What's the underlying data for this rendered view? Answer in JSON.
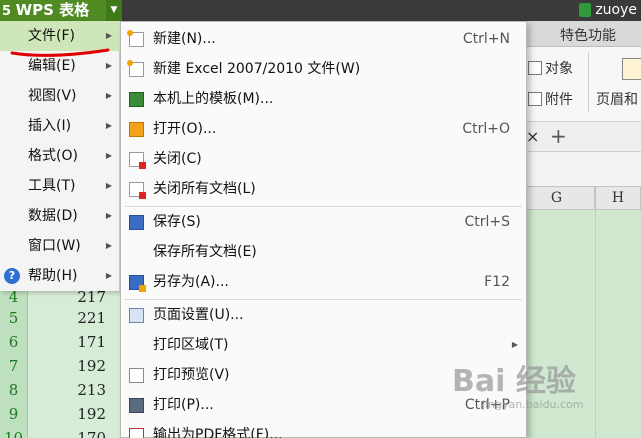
{
  "titlebar": {
    "app_label": "WPS 表格",
    "user_name": "zuoye"
  },
  "ribbon": {
    "tab_label": "特色功能",
    "object_label": "对象",
    "attachment_label": "附件",
    "header_footer_label": "页眉和"
  },
  "sheet": {
    "close_tab": "×",
    "add_tab": "+",
    "columns": [
      "G",
      "H"
    ],
    "rows": [
      {
        "num": "4",
        "value": "217"
      },
      {
        "num": "5",
        "value": "221"
      },
      {
        "num": "6",
        "value": "171"
      },
      {
        "num": "7",
        "value": "192"
      },
      {
        "num": "8",
        "value": "213"
      },
      {
        "num": "9",
        "value": "192"
      },
      {
        "num": "10",
        "value": "170"
      }
    ]
  },
  "main_menu": {
    "items": [
      {
        "label": "文件(F)"
      },
      {
        "label": "编辑(E)"
      },
      {
        "label": "视图(V)"
      },
      {
        "label": "插入(I)"
      },
      {
        "label": "格式(O)"
      },
      {
        "label": "工具(T)"
      },
      {
        "label": "数据(D)"
      },
      {
        "label": "窗口(W)"
      },
      {
        "label": "帮助(H)"
      }
    ]
  },
  "file_menu": {
    "items": [
      {
        "label": "新建(N)...",
        "shortcut": "Ctrl+N",
        "icon": "new-doc-icon"
      },
      {
        "label": "新建 Excel 2007/2010 文件(W)",
        "shortcut": "",
        "icon": "new-excel-icon"
      },
      {
        "label": "本机上的模板(M)...",
        "shortcut": "",
        "icon": "template-icon"
      },
      {
        "label": "打开(O)...",
        "shortcut": "Ctrl+O",
        "icon": "open-folder-icon"
      },
      {
        "label": "关闭(C)",
        "shortcut": "",
        "icon": "close-doc-icon"
      },
      {
        "label": "关闭所有文档(L)",
        "shortcut": "",
        "icon": "close-all-icon"
      },
      {
        "label": "保存(S)",
        "shortcut": "Ctrl+S",
        "icon": "save-icon"
      },
      {
        "label": "保存所有文档(E)",
        "shortcut": "",
        "icon": ""
      },
      {
        "label": "另存为(A)...",
        "shortcut": "F12",
        "icon": "save-as-icon"
      },
      {
        "label": "页面设置(U)...",
        "shortcut": "",
        "icon": "page-setup-icon"
      },
      {
        "label": "打印区域(T)",
        "shortcut": "",
        "icon": ""
      },
      {
        "label": "打印预览(V)",
        "shortcut": "",
        "icon": "print-preview-icon"
      },
      {
        "label": "打印(P)...",
        "shortcut": "Ctrl+P",
        "icon": "print-icon"
      },
      {
        "label": "输出为PDF格式(F)...",
        "shortcut": "",
        "icon": "pdf-icon"
      }
    ]
  },
  "watermark": {
    "brand": "Bai 经验",
    "url": "jingyan.baidu.com"
  },
  "colors": {
    "wps_green": "#4f8a23",
    "menu_highlight": "#cfe6b8",
    "sheet_green": "#cfe8cf"
  }
}
